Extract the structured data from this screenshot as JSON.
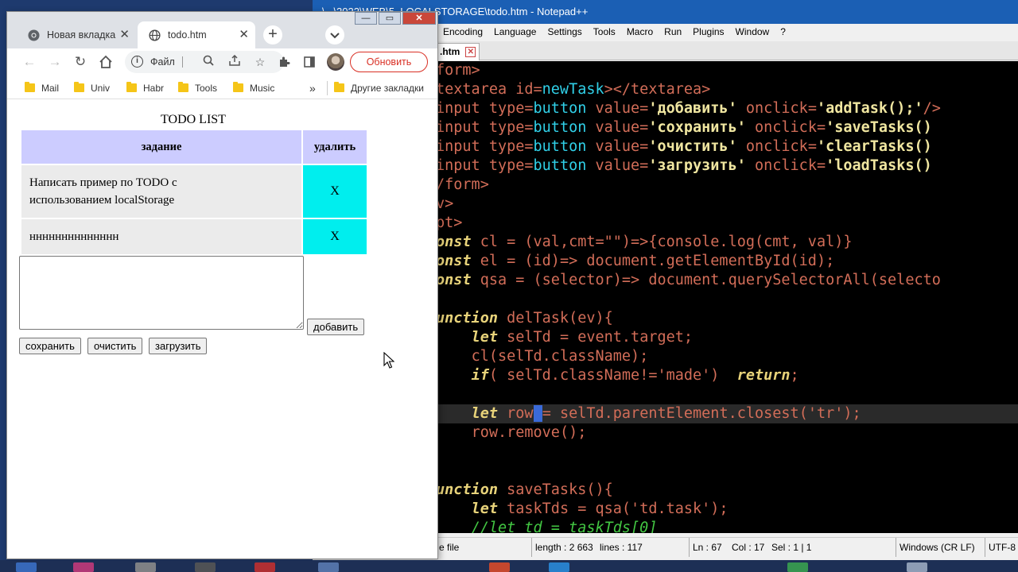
{
  "notepad": {
    "title": "\\...\\2022\\WEB\\5_LOCALSTORAGE\\todo.htm - Notepad++",
    "menu": [
      "Encoding",
      "Language",
      "Settings",
      "Tools",
      "Macro",
      "Run",
      "Plugins",
      "Window",
      "?"
    ],
    "tab_label": ".htm",
    "code": [
      {
        "pre": "form>"
      },
      {
        "pre": "textarea id=",
        "attr": "newTask",
        "post": "></textarea>"
      },
      {
        "pre": "input type=",
        "attr": "button",
        "mid": " value=",
        "str": "'добавить'",
        "mid2": " onclick=",
        "str2": "'addTask();'",
        "post": "/>"
      },
      {
        "pre": "input type=",
        "attr": "button",
        "mid": " value=",
        "str": "'сохранить'",
        "mid2": " onclick=",
        "str2": "'saveTasks()"
      },
      {
        "pre": "input type=",
        "attr": "button",
        "mid": " value=",
        "str": "'очистить'",
        "mid2": " onclick=",
        "str2": "'clearTasks()"
      },
      {
        "pre": "input type=",
        "attr": "button",
        "mid": " value=",
        "str": "'загрузить'",
        "mid2": " onclick=",
        "str2": "'loadTasks()"
      },
      {
        "pre": "/form>"
      },
      {
        "pre": "v>"
      },
      {
        "pre": "pt>"
      },
      {
        "kw": "onst",
        "pre": " cl = (val,cmt=\"\")=>{console.log(cmt, val)}"
      },
      {
        "kw": "onst",
        "pre": " el = (id)=> document.getElementById(id);"
      },
      {
        "kw": "onst",
        "pre": " qsa = (selector)=> document.querySelectorAll(selecto"
      },
      {
        "pre": ""
      },
      {
        "kw": "unction",
        "pre": " delTask(ev){"
      },
      {
        "ind": "    ",
        "kw": "let",
        "pre": " selTd = event.target;"
      },
      {
        "ind": "    ",
        "pre": "cl(selTd.className);"
      },
      {
        "ind": "    ",
        "kw": "if",
        "pre": "( selTd.className!='made')  ",
        "kw2": "return",
        "post": ";"
      },
      {
        "pre": ""
      },
      {
        "ind": "    ",
        "kw": "let",
        "pre": " row",
        "sel": " ",
        "post": "= selTd.parentElement.closest('tr');"
      },
      {
        "ind": "    ",
        "pre": "row.remove();"
      },
      {
        "pre": ""
      },
      {
        "pre": ""
      },
      {
        "kw": "unction",
        "pre": " saveTasks(){"
      },
      {
        "ind": "    ",
        "kw": "let",
        "pre": " taskTds = qsa('td.task');"
      },
      {
        "ind": "    ",
        "cm": "//let td = taskTds[0]"
      }
    ],
    "status": {
      "file_type": "e file",
      "length": "length : 2 663",
      "lines": "lines : 117",
      "ln": "Ln : 67",
      "col": "Col : 17",
      "sel": "Sel : 1 | 1",
      "eol": "Windows (CR LF)",
      "enc": "UTF-8"
    }
  },
  "chrome": {
    "tabs": [
      {
        "label": "Новая вкладка"
      },
      {
        "label": "todo.htm"
      }
    ],
    "omnibox_label": "Файл",
    "update_label": "Обновить",
    "bookmarks": [
      "Mail",
      "Univ",
      "Habr",
      "Tools",
      "Music"
    ],
    "bookmarks_more": "»",
    "other_bookmarks": "Другие закладки",
    "window_controls": {
      "minimize": "—",
      "maximize": "▭",
      "close": "✕"
    }
  },
  "todo": {
    "title": "TODO LIST",
    "headers": [
      "задание",
      "удалить"
    ],
    "rows": [
      {
        "task_line1": "Написать пример по TODO с",
        "task_line2": "использованием localStorage",
        "delete": "X"
      },
      {
        "task_line1": "нннннннннннннн",
        "task_line2": "",
        "delete": "X"
      }
    ],
    "input_value": "",
    "buttons": {
      "add": "добавить",
      "save": "сохранить",
      "clear": "очистить",
      "load": "загрузить"
    }
  },
  "colors": {
    "header_bg": "#ccccff",
    "task_bg": "#ebebeb",
    "delete_bg": "#00eeee",
    "update_red": "#d93025"
  }
}
